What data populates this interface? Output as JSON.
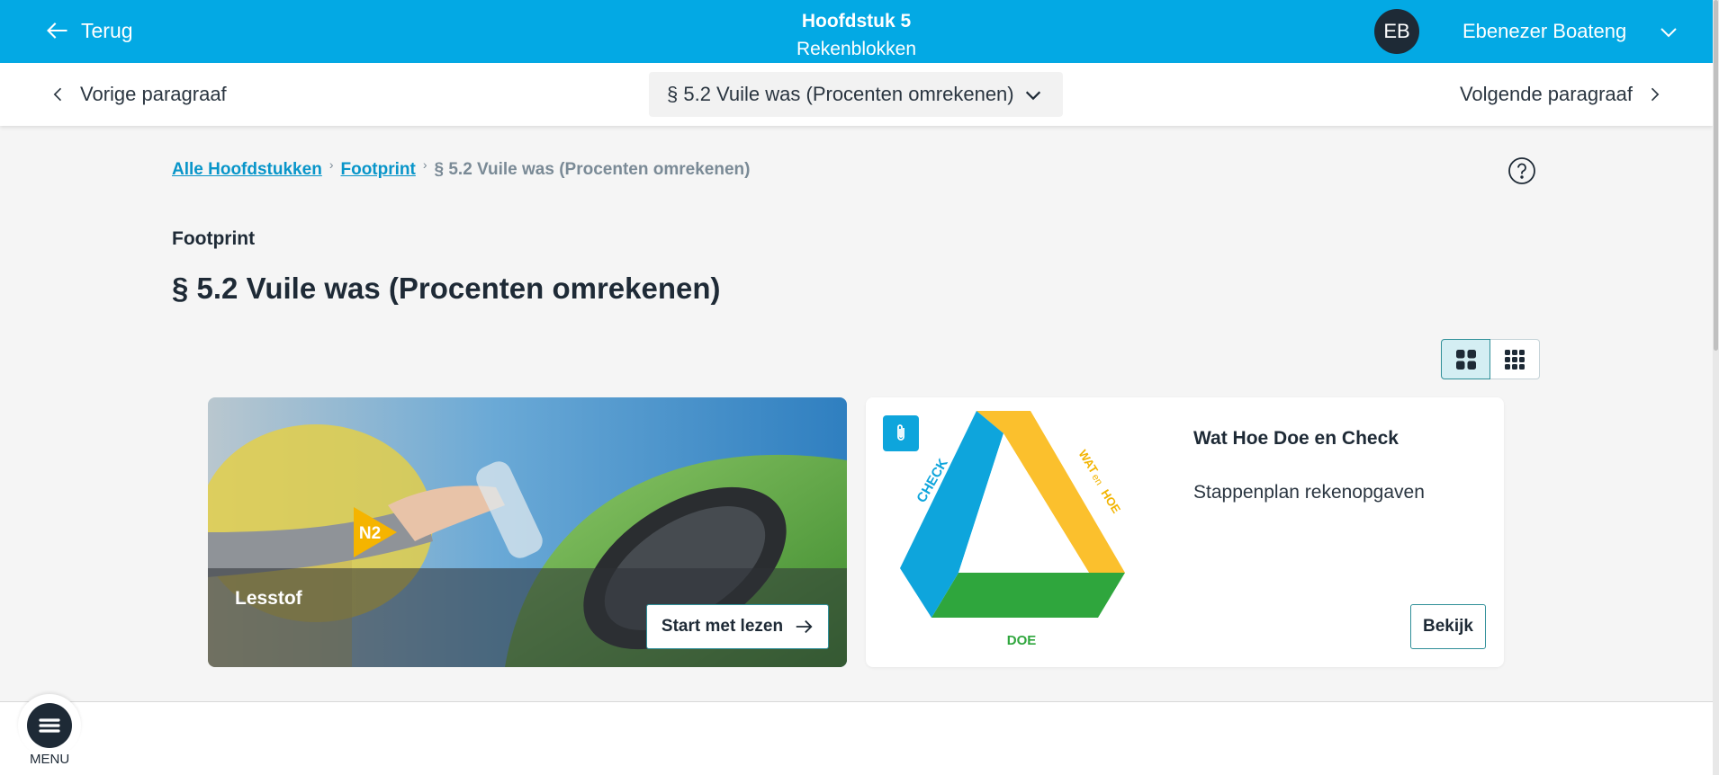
{
  "header": {
    "back_label": "Terug",
    "chapter_title": "Hoofdstuk 5",
    "chapter_subtitle": "Rekenblokken",
    "user_initials": "EB",
    "user_name": "Ebenezer Boateng",
    "accent_color": "#03a9e4"
  },
  "subnav": {
    "prev_label": "Vorige paragraaf",
    "next_label": "Volgende paragraaf",
    "selected_paragraph": "§ 5.2 Vuile was (Procenten omrekenen)"
  },
  "breadcrumb": {
    "items": [
      "Alle Hoofdstukken",
      "Footprint"
    ],
    "current": "§ 5.2 Vuile was (Procenten omrekenen)"
  },
  "page": {
    "chapter_label": "Footprint",
    "title": "§ 5.2 Vuile was (Procenten omrekenen)"
  },
  "cards": {
    "lesson": {
      "label": "Lesstof",
      "badge": "N2",
      "button": "Start met lezen"
    },
    "whdc": {
      "title": "Wat Hoe Doe en Check",
      "description": "Stappenplan rekenopgaven",
      "button": "Bekijk",
      "diagram_labels": {
        "check": "CHECK",
        "wat": "WAT",
        "en": "en",
        "hoe": "HOE",
        "doe": "DOE"
      }
    }
  },
  "bottom": {
    "menu_label": "MENU"
  },
  "icons": [
    "arrow-left-icon",
    "chevron-down-icon",
    "chevron-left-icon",
    "chevron-right-icon",
    "help-icon",
    "grid-large-icon",
    "grid-small-icon",
    "arrow-right-icon",
    "paperclip-icon",
    "menu-icon"
  ]
}
